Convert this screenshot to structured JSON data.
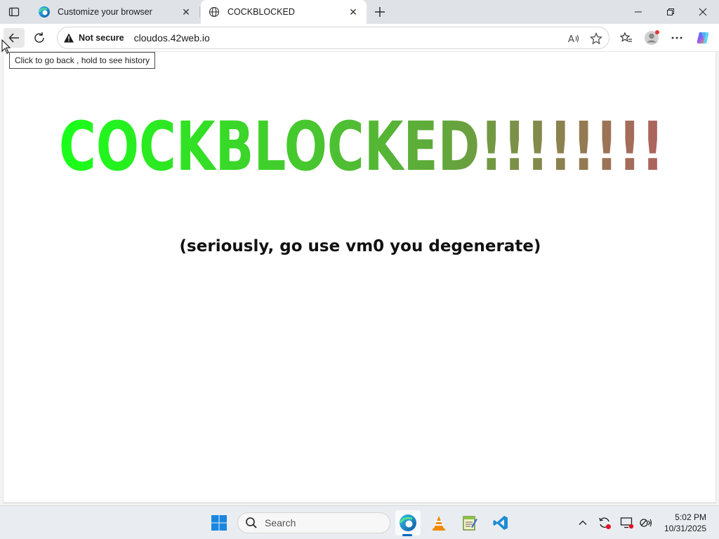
{
  "browser": {
    "tabs": [
      {
        "label": "Customize your browser",
        "icon": "edge-icon",
        "active": false
      },
      {
        "label": "COCKBLOCKED",
        "icon": "globe-icon",
        "active": true
      }
    ],
    "address": {
      "security_label": "Not secure",
      "url": "cloudos.42web.io"
    },
    "tooltip": "Click to go back , hold to see history"
  },
  "page": {
    "headline": "COCKBLOCKED!!!!!!!!",
    "subtitle": "(seriously, go use vm0 you degenerate)",
    "colors": {
      "start": "#19ff19",
      "mid": "#5faa3a",
      "end": "#b0615f"
    }
  },
  "taskbar": {
    "search_placeholder": "Search",
    "time": "5:02 PM",
    "date": "10/31/2025",
    "apps": [
      "windows-start-icon",
      "edge-icon",
      "vlc-icon",
      "notepad-icon",
      "vscode-icon"
    ]
  }
}
